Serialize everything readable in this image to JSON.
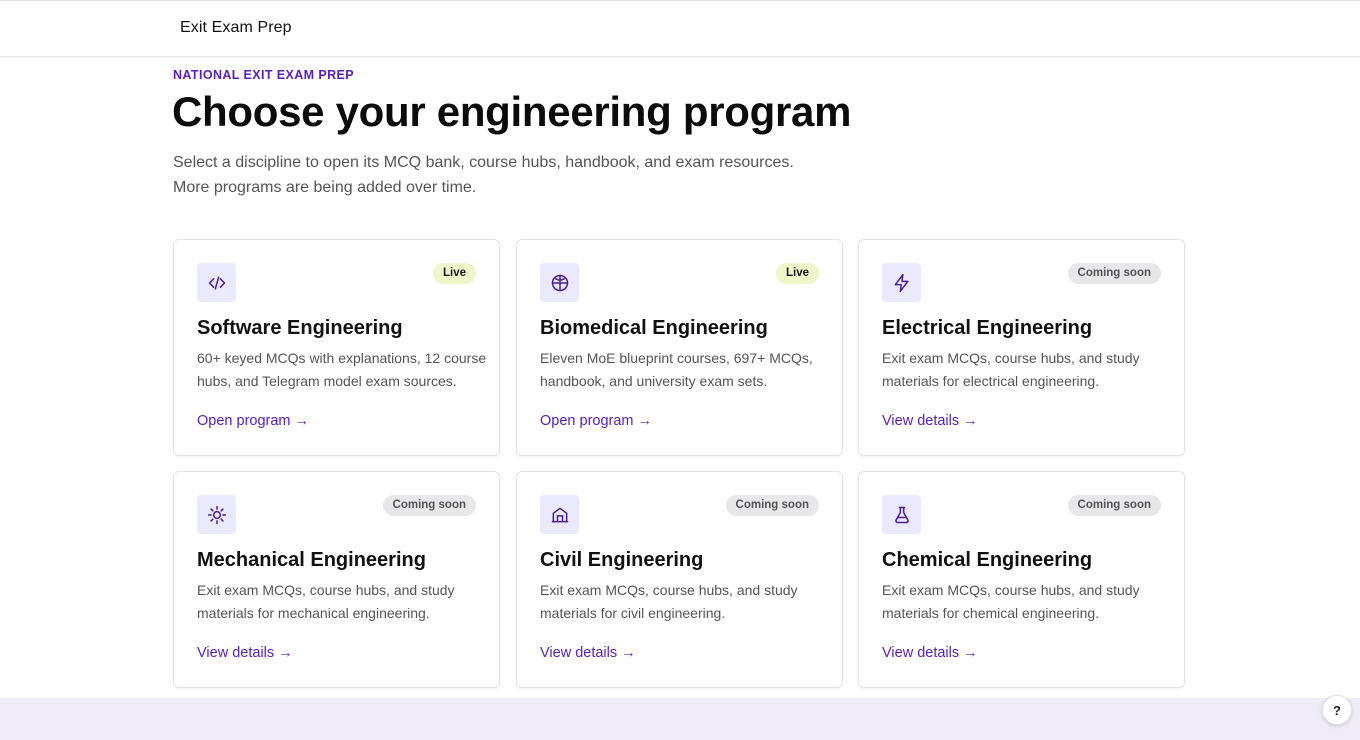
{
  "header": {
    "brand": "Exit Exam Prep"
  },
  "hero": {
    "eyebrow": "NATIONAL EXIT EXAM PREP",
    "title": "Choose your engineering program",
    "intro": "Select a discipline to open its MCQ bank, course hubs, handbook, and exam resources. More programs are being added over time."
  },
  "colors": {
    "accent": "#5b21b6",
    "icon_bg": "#ebe9fe",
    "live_badge": "#edf7c9",
    "soon_badge": "#e8e8ea",
    "footer_band": "#efecf8"
  },
  "programs": [
    {
      "icon": "code-icon",
      "badge": "Live",
      "status": "live",
      "title": "Software Engineering",
      "description": "60+ keyed MCQs with explanations, 12 course hubs, and Telegram model exam sources.",
      "link": "Open program →"
    },
    {
      "icon": "globe-icon",
      "badge": "Live",
      "status": "live",
      "title": "Biomedical Engineering",
      "description": "Eleven MoE blueprint courses, 697+ MCQs, handbook, and university exam sets.",
      "link": "Open program →"
    },
    {
      "icon": "lightning-icon",
      "badge": "Coming soon",
      "status": "soon",
      "title": "Electrical Engineering",
      "description": "Exit exam MCQs, course hubs, and study materials for electrical engineering.",
      "link": "View details →"
    },
    {
      "icon": "gear-icon",
      "badge": "Coming soon",
      "status": "soon",
      "title": "Mechanical Engineering",
      "description": "Exit exam MCQs, course hubs, and study materials for mechanical engineering.",
      "link": "View details →"
    },
    {
      "icon": "building-icon",
      "badge": "Coming soon",
      "status": "soon",
      "title": "Civil Engineering",
      "description": "Exit exam MCQs, course hubs, and study materials for civil engineering.",
      "link": "View details →"
    },
    {
      "icon": "flask-icon",
      "badge": "Coming soon",
      "status": "soon",
      "title": "Chemical Engineering",
      "description": "Exit exam MCQs, course hubs, and study materials for chemical engineering.",
      "link": "View details →"
    }
  ],
  "help": {
    "label": "?"
  }
}
